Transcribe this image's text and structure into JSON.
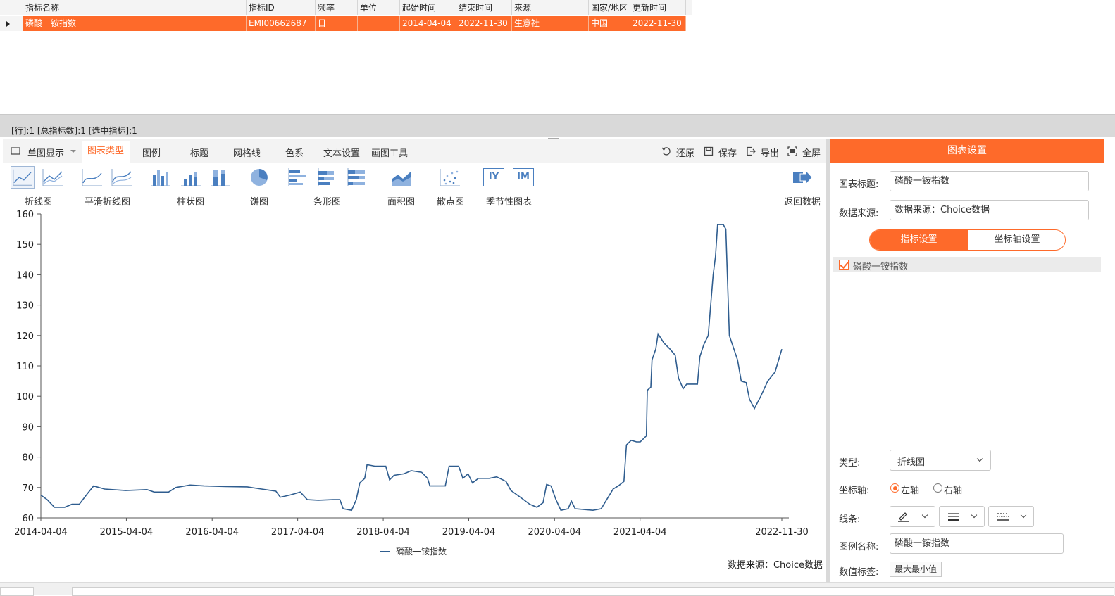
{
  "grid": {
    "columns": [
      "指标名称",
      "指标ID",
      "频率",
      "单位",
      "起始时间",
      "结束时间",
      "来源",
      "国家/地区",
      "更新时间"
    ],
    "rows": [
      [
        "磷酸一铵指数",
        "EMI00662687",
        "日",
        "",
        "2014-04-04",
        "2022-11-30",
        "生意社",
        "中国",
        "2022-11-30"
      ]
    ]
  },
  "status": {
    "text": "[行]:1  [总指标数]:1  [选中指标]:1"
  },
  "toolbar": {
    "single_view": "单图显示",
    "tabs": [
      "图表类型",
      "图例",
      "标题",
      "网格线",
      "色系",
      "文本设置",
      "画图工具"
    ],
    "active_tab": "图表类型",
    "actions": {
      "restore": "还原",
      "save": "保存",
      "export": "导出",
      "fullscreen": "全屏"
    }
  },
  "ribbon": {
    "groups": [
      {
        "label": "折线图"
      },
      {
        "label": "平滑折线图"
      },
      {
        "label": "柱状图"
      },
      {
        "label": "饼图"
      },
      {
        "label": "条形图"
      },
      {
        "label": "面积图"
      },
      {
        "label": "散点图"
      },
      {
        "label": "季节性图表"
      }
    ],
    "seasonal_icons": [
      "IY",
      "IM"
    ],
    "back": "返回数据"
  },
  "chart_data": {
    "type": "line",
    "x_tick_labels": [
      "2014-04-04",
      "2015-04-04",
      "2016-04-04",
      "2017-04-04",
      "2018-04-04",
      "2019-04-04",
      "2020-04-04",
      "2021-04-04",
      "2022-11-30"
    ],
    "x_range": [
      "2014-04-04",
      "2022-11-30"
    ],
    "ylim": [
      60,
      160
    ],
    "y_ticks": [
      60,
      70,
      80,
      90,
      100,
      110,
      120,
      130,
      140,
      150,
      160
    ],
    "grid": false,
    "legend_position": "bottom-center",
    "series": [
      {
        "name": "磷酸一铵指数",
        "color": "#2f5d8f",
        "points": [
          [
            "2014-04-04",
            67.5
          ],
          [
            "2014-05-01",
            66
          ],
          [
            "2014-06-01",
            63.5
          ],
          [
            "2014-07-15",
            63.5
          ],
          [
            "2014-08-15",
            64.5
          ],
          [
            "2014-09-15",
            64.5
          ],
          [
            "2014-10-20",
            68
          ],
          [
            "2014-11-15",
            70.5
          ],
          [
            "2015-01-01",
            69.5
          ],
          [
            "2015-04-01",
            69
          ],
          [
            "2015-07-01",
            69.3
          ],
          [
            "2015-08-01",
            68.5
          ],
          [
            "2015-10-01",
            68.5
          ],
          [
            "2015-11-01",
            70
          ],
          [
            "2016-01-01",
            70.8
          ],
          [
            "2016-03-01",
            70.5
          ],
          [
            "2016-06-01",
            70.3
          ],
          [
            "2016-09-01",
            70.2
          ],
          [
            "2016-11-01",
            69.5
          ],
          [
            "2017-01-01",
            68.8
          ],
          [
            "2017-01-20",
            66.8
          ],
          [
            "2017-03-01",
            67.5
          ],
          [
            "2017-04-15",
            68.5
          ],
          [
            "2017-05-15",
            66
          ],
          [
            "2017-07-01",
            65.8
          ],
          [
            "2017-09-01",
            66
          ],
          [
            "2017-10-01",
            66
          ],
          [
            "2017-10-15",
            63
          ],
          [
            "2017-11-20",
            62.5
          ],
          [
            "2017-12-10",
            66
          ],
          [
            "2017-12-25",
            71.5
          ],
          [
            "2018-01-15",
            73
          ],
          [
            "2018-01-25",
            77.5
          ],
          [
            "2018-03-01",
            77
          ],
          [
            "2018-04-15",
            77
          ],
          [
            "2018-05-01",
            72.5
          ],
          [
            "2018-05-20",
            74
          ],
          [
            "2018-07-01",
            74.5
          ],
          [
            "2018-08-01",
            75.5
          ],
          [
            "2018-09-15",
            75
          ],
          [
            "2018-10-10",
            73
          ],
          [
            "2018-10-20",
            70.5
          ],
          [
            "2018-12-25",
            70.5
          ],
          [
            "2019-01-10",
            77
          ],
          [
            "2019-02-20",
            77
          ],
          [
            "2019-03-10",
            73
          ],
          [
            "2019-04-01",
            74.5
          ],
          [
            "2019-04-20",
            71.5
          ],
          [
            "2019-05-15",
            73
          ],
          [
            "2019-07-01",
            73
          ],
          [
            "2019-08-01",
            73.5
          ],
          [
            "2019-09-10",
            72
          ],
          [
            "2019-10-01",
            69
          ],
          [
            "2019-11-15",
            66.5
          ],
          [
            "2019-12-20",
            64.5
          ],
          [
            "2020-01-20",
            63.5
          ],
          [
            "2020-02-15",
            65
          ],
          [
            "2020-03-01",
            71
          ],
          [
            "2020-03-20",
            70.5
          ],
          [
            "2020-04-10",
            66
          ],
          [
            "2020-05-01",
            62.5
          ],
          [
            "2020-06-01",
            63
          ],
          [
            "2020-06-15",
            65.5
          ],
          [
            "2020-07-01",
            63
          ],
          [
            "2020-09-15",
            62.5
          ],
          [
            "2020-10-20",
            63
          ],
          [
            "2020-12-10",
            69.5
          ],
          [
            "2021-01-01",
            70.5
          ],
          [
            "2021-01-25",
            72
          ],
          [
            "2021-02-05",
            84
          ],
          [
            "2021-02-25",
            85.5
          ],
          [
            "2021-03-20",
            85
          ],
          [
            "2021-04-05",
            85
          ],
          [
            "2021-05-01",
            87
          ],
          [
            "2021-05-05",
            102
          ],
          [
            "2021-05-20",
            103
          ],
          [
            "2021-05-25",
            112
          ],
          [
            "2021-06-10",
            115.5
          ],
          [
            "2021-06-20",
            120.5
          ],
          [
            "2021-07-15",
            117.5
          ],
          [
            "2021-08-10",
            115.5
          ],
          [
            "2021-09-01",
            113.5
          ],
          [
            "2021-09-15",
            106
          ],
          [
            "2021-10-05",
            102.5
          ],
          [
            "2021-10-20",
            104
          ],
          [
            "2021-12-05",
            104
          ],
          [
            "2021-12-15",
            113
          ],
          [
            "2022-01-01",
            117
          ],
          [
            "2022-01-20",
            120
          ],
          [
            "2022-02-10",
            140
          ],
          [
            "2022-02-20",
            146
          ],
          [
            "2022-03-01",
            156.5
          ],
          [
            "2022-03-25",
            156.5
          ],
          [
            "2022-04-05",
            155
          ],
          [
            "2022-04-20",
            120
          ],
          [
            "2022-05-01",
            117.5
          ],
          [
            "2022-05-25",
            112
          ],
          [
            "2022-06-10",
            105
          ],
          [
            "2022-07-01",
            104.5
          ],
          [
            "2022-07-15",
            99
          ],
          [
            "2022-08-05",
            96
          ],
          [
            "2022-09-01",
            100
          ],
          [
            "2022-10-01",
            105
          ],
          [
            "2022-11-01",
            108
          ],
          [
            "2022-11-30",
            115.5
          ]
        ]
      }
    ],
    "source_note": "数据来源：Choice数据"
  },
  "settings": {
    "header": "图表设置",
    "chart_title_label": "图表标题:",
    "chart_title_value": "磷酸一铵指数",
    "source_label": "数据来源:",
    "source_value": "数据来源：Choice数据",
    "seg_on": "指标设置",
    "seg_off": "坐标轴设置",
    "series_item": "磷酸一铵指数",
    "type_label": "类型:",
    "type_value": "折线图",
    "axis_label": "坐标轴:",
    "axis_left": "左轴",
    "axis_right": "右轴",
    "line_label": "线条:",
    "legend_name_label": "图例名称:",
    "legend_name_value": "磷酸一铵指数",
    "value_label_label": "数值标签:",
    "value_label_btn": "最大最小值",
    "accent": "#fe6a2a"
  }
}
